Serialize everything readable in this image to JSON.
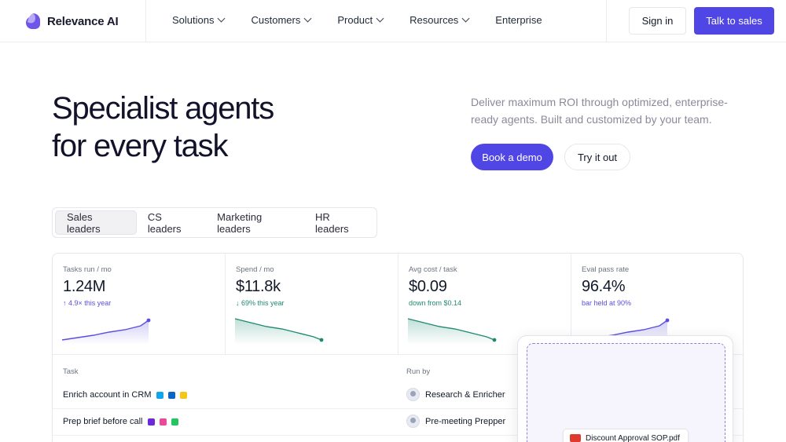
{
  "header": {
    "brand": "Relevance AI",
    "nav": [
      {
        "label": "Solutions",
        "dropdown": true
      },
      {
        "label": "Customers",
        "dropdown": true
      },
      {
        "label": "Product",
        "dropdown": true
      },
      {
        "label": "Resources",
        "dropdown": true
      },
      {
        "label": "Enterprise",
        "dropdown": false
      }
    ],
    "sign_in": "Sign in",
    "talk_to_sales": "Talk to sales"
  },
  "hero": {
    "title_line1": "Specialist agents",
    "title_line2": "for every task",
    "subtitle": "Deliver maximum ROI through optimized, enterprise-ready agents. Built and customized by your team.",
    "primary_cta": "Book a demo",
    "secondary_cta": "Try it out"
  },
  "tabs": [
    "Sales leaders",
    "CS leaders",
    "Marketing leaders",
    "HR leaders"
  ],
  "active_tab": "Sales leaders",
  "metrics": [
    {
      "label": "Tasks run / mo",
      "value": "1.24M",
      "delta": "↑ 4.9× this year",
      "delta_color": "#5b4ee0",
      "trend": "up",
      "line_color": "#5b4ee0"
    },
    {
      "label": "Spend / mo",
      "value": "$11.8k",
      "delta": "↓ 69% this year",
      "delta_color": "#1f8a70",
      "trend": "down",
      "line_color": "#1f8a70"
    },
    {
      "label": "Avg cost / task",
      "value": "$0.09",
      "delta": "down from $0.14",
      "delta_color": "#1f8a70",
      "trend": "down",
      "line_color": "#1f8a70"
    },
    {
      "label": "Eval pass rate",
      "value": "96.4%",
      "delta": "bar held at 90%",
      "delta_color": "#5b4ee0",
      "trend": "up",
      "line_color": "#5b4ee0"
    }
  ],
  "table": {
    "col_task": "Task",
    "col_run_by": "Run by",
    "rows": [
      {
        "task": "Enrich account in CRM",
        "run_by": "Research & Enricher",
        "integrations": [
          "#0ea5e9",
          "#0a66c2",
          "#f5c518"
        ]
      },
      {
        "task": "Prep brief before call",
        "run_by": "Pre-meeting Prepper",
        "integrations": [
          "#6d28d9",
          "#ec4899",
          "#22c55e"
        ]
      }
    ]
  },
  "upload": {
    "file_name": "Discount Approval SOP.pdf"
  },
  "colors": {
    "accent": "#5046e5",
    "text_muted": "#8a8a99"
  }
}
